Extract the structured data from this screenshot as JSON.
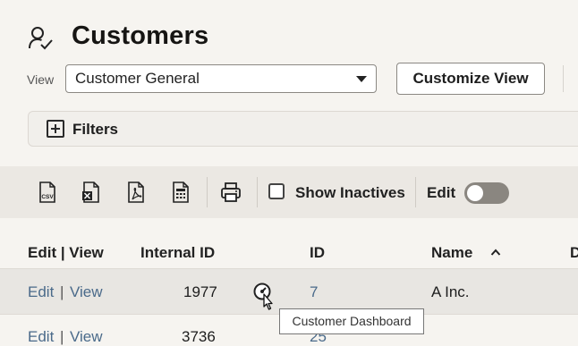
{
  "header": {
    "title": "Customers",
    "view_label": "View",
    "view_selected": "Customer General",
    "customize_label": "Customize View"
  },
  "filters": {
    "label": "Filters"
  },
  "toolbar": {
    "icons": [
      "csv-export-icon",
      "excel-export-icon",
      "pdf-export-icon",
      "spreadsheet-export-icon",
      "print-icon"
    ],
    "show_inactives_label": "Show Inactives",
    "edit_label": "Edit",
    "edit_toggle_on": false
  },
  "table": {
    "columns": [
      "Edit | View",
      "Internal ID",
      "ID",
      "Name",
      "D"
    ],
    "sort_indicator": "^",
    "rows": [
      {
        "edit": "Edit",
        "sep": "|",
        "view": "View",
        "internal_id": "1977",
        "id": "7",
        "name": "A Inc."
      },
      {
        "edit": "Edit",
        "sep": "|",
        "view": "View",
        "internal_id": "3736",
        "id": "25",
        "name": ""
      }
    ]
  },
  "tooltip": {
    "text": "Customer Dashboard"
  }
}
